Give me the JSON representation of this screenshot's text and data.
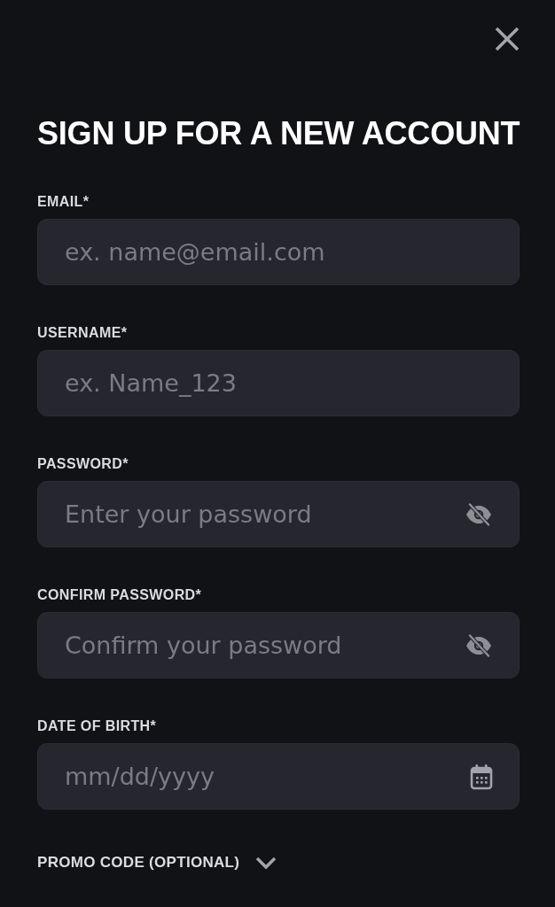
{
  "dialog": {
    "title": "SIGN UP FOR A NEW ACCOUNT"
  },
  "fields": [
    {
      "kind": "text",
      "label": "EMAIL*",
      "placeholder": "ex. name@email.com"
    },
    {
      "kind": "text",
      "label": "USERNAME*",
      "placeholder": "ex. Name_123"
    },
    {
      "kind": "password",
      "label": "PASSWORD*",
      "placeholder": "Enter your password"
    },
    {
      "kind": "password",
      "label": "CONFIRM PASSWORD*",
      "placeholder": "Confirm your password"
    },
    {
      "kind": "date",
      "label": "DATE OF BIRTH*",
      "placeholder": "mm/dd/yyyy"
    }
  ],
  "promo_code": {
    "label": "PROMO CODE (OPTIONAL)",
    "expanded": false
  }
}
